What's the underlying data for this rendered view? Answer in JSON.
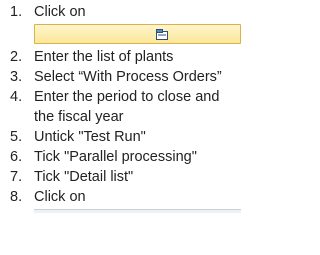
{
  "steps": [
    {
      "num": "1.",
      "text": "Click on"
    },
    {
      "num": "2.",
      "text": "Enter the list of plants"
    },
    {
      "num": "3.",
      "text": "Select “With Process Orders”"
    },
    {
      "num": "4.",
      "text": "Enter the period to close and",
      "cont": "the fiscal year"
    },
    {
      "num": "5.",
      "text": "Untick \"Test Run\""
    },
    {
      "num": "6.",
      "text": "Tick \"Parallel processing\""
    },
    {
      "num": "7.",
      "text": "Tick \"Detail list\""
    },
    {
      "num": "8.",
      "text": "Click on"
    }
  ],
  "toolbar_button": {
    "icon": "variant-folder-icon",
    "color": "#fbe79a"
  }
}
